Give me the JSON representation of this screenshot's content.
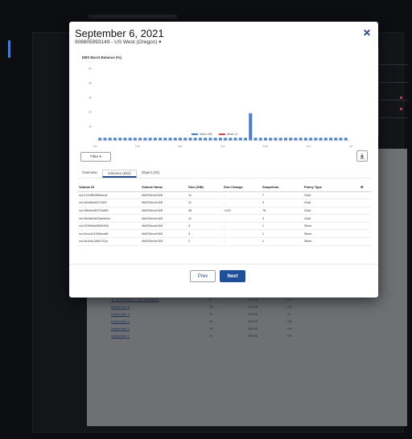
{
  "modal": {
    "title": "September 6, 2021",
    "subtitle": "908805993149 - US West (Oregon) ▾",
    "close_label": "✕",
    "chart_title": "EBS Burst Balance (%)",
    "filter_label": "Filter ▾",
    "download_icon": "download-icon",
    "tabs": [
      {
        "label": "Overview"
      },
      {
        "label": "Volumes (682)"
      },
      {
        "label": "Object (20)"
      }
    ],
    "prev_label": "Prev",
    "next_label": "Next"
  },
  "chart_data": {
    "type": "bar",
    "title": "EBS Burst Balance (%)",
    "ylabel": "",
    "yticks": [
      "50",
      "40",
      "30",
      "20",
      "10"
    ],
    "xticks": [
      "Jan",
      "Feb",
      "Mar",
      "Apr",
      "May",
      "Jun",
      "Jul"
    ],
    "ylim": [
      0,
      50
    ],
    "series": [
      {
        "name": "Week 256",
        "color": "#4a7ec2",
        "values": [
          2,
          2,
          2,
          2,
          2,
          2,
          2,
          2,
          2,
          2,
          2,
          2,
          2,
          2,
          2,
          2,
          2,
          2,
          2,
          2,
          2,
          2,
          2,
          2,
          2,
          2,
          2,
          2,
          2,
          2,
          22,
          2,
          2,
          2,
          2,
          2,
          2,
          2,
          2,
          2,
          2,
          2,
          2,
          2,
          2,
          2,
          2,
          2,
          2,
          2
        ]
      },
      {
        "name": "Week 14",
        "color": "#d0444f",
        "values": []
      }
    ]
  },
  "table": {
    "columns": [
      "Volume ID",
      "Volume Name",
      "Size (GiB)",
      "Size Change",
      "Snapshots",
      "Policy Type",
      "⚙"
    ],
    "rows": [
      [
        "vol-0124f5e9f5bdea1",
        "AWSServer028",
        "11",
        "-",
        "7",
        "Gold",
        ""
      ],
      [
        "vol-0a9d5dd31734f0",
        "AWSServer028",
        "11",
        "-",
        "3",
        "Gold",
        ""
      ],
      [
        "vol-0f5c0ed627f1e6f3",
        "AWSServer028",
        "38",
        "+120",
        "76",
        "Gold",
        ""
      ],
      [
        "vol-0fc08e5e22ae9e5d",
        "AWSServer028",
        "11",
        "-",
        "3",
        "Gold",
        ""
      ],
      [
        "vol-0339fa0e5625456",
        "AWSServer028",
        "3",
        "-",
        "1",
        "Silver",
        ""
      ],
      [
        "vol-0ece441909ecaf8",
        "AWSServer028",
        "3",
        "-",
        "1",
        "Silver",
        ""
      ],
      [
        "vol-0e2bb12830721a",
        "AWSServer028",
        "3",
        "-",
        "1",
        "Silver",
        ""
      ]
    ]
  },
  "background": {
    "rows": [
      {
        "c1": "▼ 90880599314 - US West (Ore)",
        "c2": "8",
        "c3": "211.98",
        "c4": "+21"
      },
      {
        "c1": "September 5",
        "c2": "15",
        "c3": "211.98",
        "c4": "+21"
      },
      {
        "c1": "September 4",
        "c2": "22",
        "c3": "500.98",
        "c4": "+9"
      },
      {
        "c1": "September 3",
        "c2": "18",
        "c3": "598.98",
        "c4": "+35"
      },
      {
        "c1": "September 2",
        "c2": "18",
        "c3": "388.98",
        "c4": "+18"
      },
      {
        "c1": "September 1",
        "c2": "11",
        "c3": "598.98",
        "c4": "+35"
      }
    ]
  }
}
